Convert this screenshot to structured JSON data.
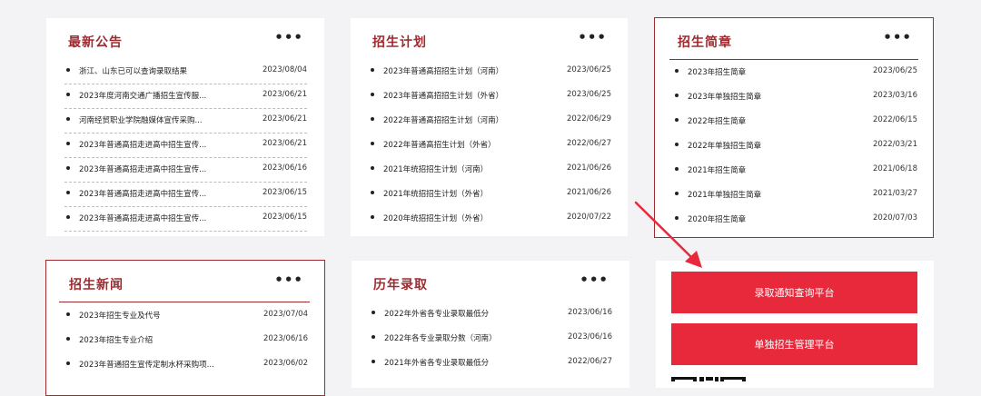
{
  "panels": {
    "notice": {
      "title": "最新公告",
      "more": "•••",
      "items": [
        {
          "title": "浙江、山东已可以查询录取结果",
          "date": "2023/08/04"
        },
        {
          "title": "2023年度河南交通广播招生宣传服...",
          "date": "2023/06/21"
        },
        {
          "title": "河南经贸职业学院融媒体宣传采购...",
          "date": "2023/06/21"
        },
        {
          "title": "2023年普通高招走进高中招生宣传...",
          "date": "2023/06/21"
        },
        {
          "title": "2023年普通高招走进高中招生宣传...",
          "date": "2023/06/16"
        },
        {
          "title": "2023年普通高招走进高中招生宣传...",
          "date": "2023/06/15"
        },
        {
          "title": "2023年普通高招走进高中招生宣传...",
          "date": "2023/06/15"
        }
      ]
    },
    "plan": {
      "title": "招生计划",
      "more": "•••",
      "items": [
        {
          "title": "2023年普通高招招生计划（河南）",
          "date": "2023/06/25"
        },
        {
          "title": "2023年普通高招招生计划（外省）",
          "date": "2023/06/25"
        },
        {
          "title": "2022年普通高招招生计划（河南）",
          "date": "2022/06/29"
        },
        {
          "title": "2022年普通高招生计划（外省）",
          "date": "2022/06/27"
        },
        {
          "title": "2021年统招招生计划（河南）",
          "date": "2021/06/26"
        },
        {
          "title": "2021年统招招生计划（外省）",
          "date": "2021/06/26"
        },
        {
          "title": "2020年统招招生计划（外省）",
          "date": "2020/07/22"
        }
      ]
    },
    "brochure": {
      "title": "招生简章",
      "more": "•••",
      "items": [
        {
          "title": "2023年招生简章",
          "date": "2023/06/25"
        },
        {
          "title": "2023年单独招生简章",
          "date": "2023/03/16"
        },
        {
          "title": "2022年招生简章",
          "date": "2022/06/15"
        },
        {
          "title": "2022年单独招生简章",
          "date": "2022/03/21"
        },
        {
          "title": "2021年招生简章",
          "date": "2021/06/18"
        },
        {
          "title": "2021年单独招生简章",
          "date": "2021/03/27"
        },
        {
          "title": "2020年招生简章",
          "date": "2020/07/03"
        }
      ]
    },
    "news": {
      "title": "招生新闻",
      "more": "•••",
      "items": [
        {
          "title": "2023年招生专业及代号",
          "date": "2023/07/04"
        },
        {
          "title": "2023年招生专业介绍",
          "date": "2023/06/16"
        },
        {
          "title": "2023年普通招生宣传定制水杯采购项...",
          "date": "2023/06/02"
        }
      ]
    },
    "history": {
      "title": "历年录取",
      "more": "•••",
      "items": [
        {
          "title": "2022年外省各专业录取最低分",
          "date": "2023/06/16"
        },
        {
          "title": "2022年各专业录取分数（河南）",
          "date": "2023/06/16"
        },
        {
          "title": "2021年外省各专业录取最低分",
          "date": "2022/06/27"
        }
      ]
    }
  },
  "buttons": {
    "admission_query": "录取通知查询平台",
    "independent_admission": "单独招生管理平台"
  },
  "colors": {
    "accent_red": "#9e2b2f",
    "button_red": "#e8293c",
    "annotation_arrow": "#e8293c"
  },
  "icons": {
    "more": "more-icon",
    "qr": "qr-code-icon",
    "annotation": "arrow-annotation"
  }
}
